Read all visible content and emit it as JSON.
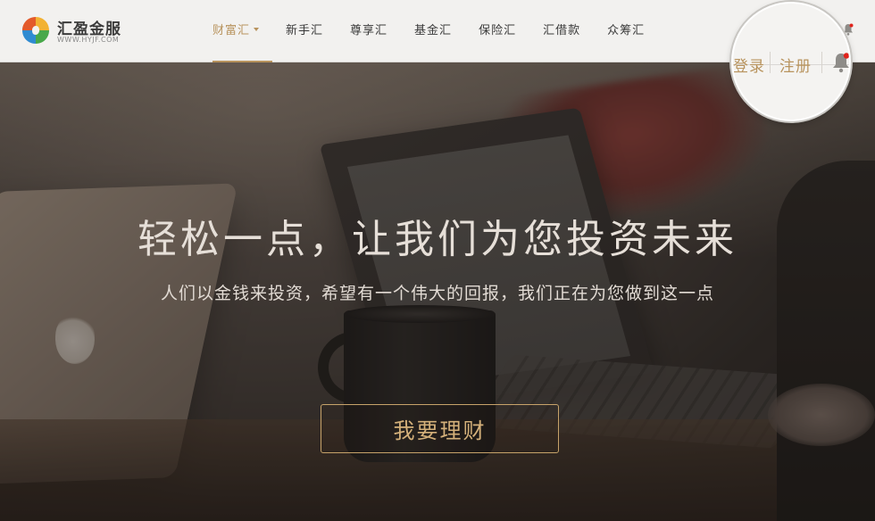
{
  "brand": {
    "name": "汇盈金服",
    "url": "WWW.HYJF.COM"
  },
  "nav": {
    "items": [
      {
        "label": "财富汇",
        "active": true,
        "has_dropdown": true
      },
      {
        "label": "新手汇",
        "active": false
      },
      {
        "label": "尊享汇",
        "active": false
      },
      {
        "label": "基金汇",
        "active": false
      },
      {
        "label": "保险汇",
        "active": false
      },
      {
        "label": "汇借款",
        "active": false
      },
      {
        "label": "众筹汇",
        "active": false
      }
    ]
  },
  "account": {
    "login_label": "登录",
    "register_label": "注册",
    "notification_icon": "bell-icon",
    "notification_dot_color": "#e0231b"
  },
  "hero": {
    "title": "轻松一点，让我们为您投资未来",
    "subtitle": "人们以金钱来投资，希望有一个伟大的回报，我们正在为您做到这一点",
    "cta_label": "我要理财"
  },
  "colors": {
    "accent": "#b8935d",
    "navbar_bg": "#f2f1ef",
    "cta_border": "#c7a36a"
  }
}
